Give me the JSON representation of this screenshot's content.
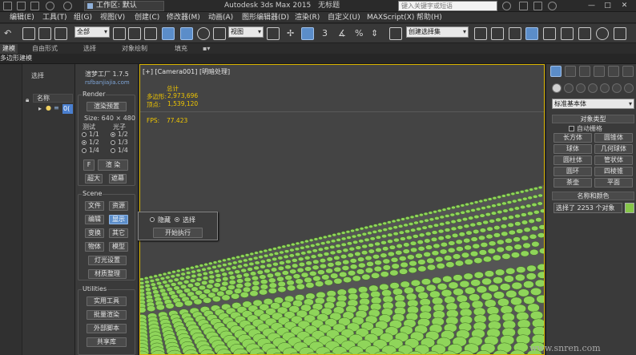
{
  "titlebar": {
    "workspace": "工作区: 默认",
    "app_title": "Autodesk 3ds Max  2015",
    "doc_title": "无标题",
    "search_placeholder": "键入关键字或短语",
    "window_controls": [
      "—",
      "□",
      "✕"
    ]
  },
  "menu": {
    "items": [
      "编辑(E)",
      "工具(T)",
      "组(G)",
      "视图(V)",
      "创建(C)",
      "修改器(M)",
      "动画(A)",
      "图形编辑器(D)",
      "渲染(R)",
      "自定义(U)",
      "MAXScript(X)",
      "帮助(H)"
    ]
  },
  "toolbar": {
    "filter_combo": "全部",
    "view_combo": "视图",
    "selection_set_placeholder": "创建选择集",
    "snap_label": "3"
  },
  "ribbon": {
    "tabs": [
      "建模",
      "自由形式",
      "选择",
      "对象绘制",
      "填充"
    ],
    "subtab": "多边形建模"
  },
  "explorer": {
    "select_label": "选择",
    "name_header": "名称",
    "row_text": "0("
  },
  "plugin": {
    "title": "渲梦工厂 1.7.5",
    "url": "rsfbanjiajia.com",
    "render": {
      "title": "Render",
      "preset_button": "渲染预置",
      "size": "Size: 640 × 480",
      "test_label": "测试",
      "photon_label": "光子",
      "test_options": [
        "1/1",
        "1/2",
        "1/4"
      ],
      "photon_options": [
        "1/2",
        "1/3",
        "1/4"
      ],
      "f_button": "F",
      "render_button": "渲 染",
      "overscan_button": "超大",
      "cancel_button": "遮幕"
    },
    "scene": {
      "title": "Scene",
      "buttons": [
        "文件",
        "资源",
        "编辑",
        "显示",
        "变换",
        "其它",
        "物体",
        "模型"
      ],
      "light_button": "灯光设置",
      "material_button": "材质整理"
    },
    "utilities": {
      "title": "Utilities",
      "buttons": [
        "实用工具",
        "批量渲染",
        "外部脚本",
        "共享库"
      ]
    }
  },
  "viewport": {
    "label": "[+] [Camera001] [明暗处理]",
    "total_label": "总计",
    "polys_label": "多边形:",
    "polys_value": "2,973,696",
    "verts_label": "顶点:",
    "verts_value": "1,539,120",
    "fps_label": "FPS:",
    "fps_value": "77.423"
  },
  "popup": {
    "hide_label": "隐藏",
    "select_label": "选择",
    "execute_button": "开始执行"
  },
  "command_panel": {
    "category_combo": "标准基本体",
    "object_type_title": "对象类型",
    "autogrid_label": "自动栅格",
    "object_buttons": [
      "长方体",
      "圆锥体",
      "球体",
      "几何球体",
      "圆柱体",
      "管状体",
      "圆环",
      "四棱锥",
      "茶壶",
      "平面"
    ],
    "name_color_title": "名称和颜色",
    "name_field": "选择了 2253 个对象",
    "object_color": "#86c64a"
  },
  "watermark": "www.snren.com",
  "colors": {
    "accent": "#5b8dc9",
    "viewport_border": "#d9b400",
    "stat_text": "#f0c600",
    "teapot": "#8fd55a"
  }
}
